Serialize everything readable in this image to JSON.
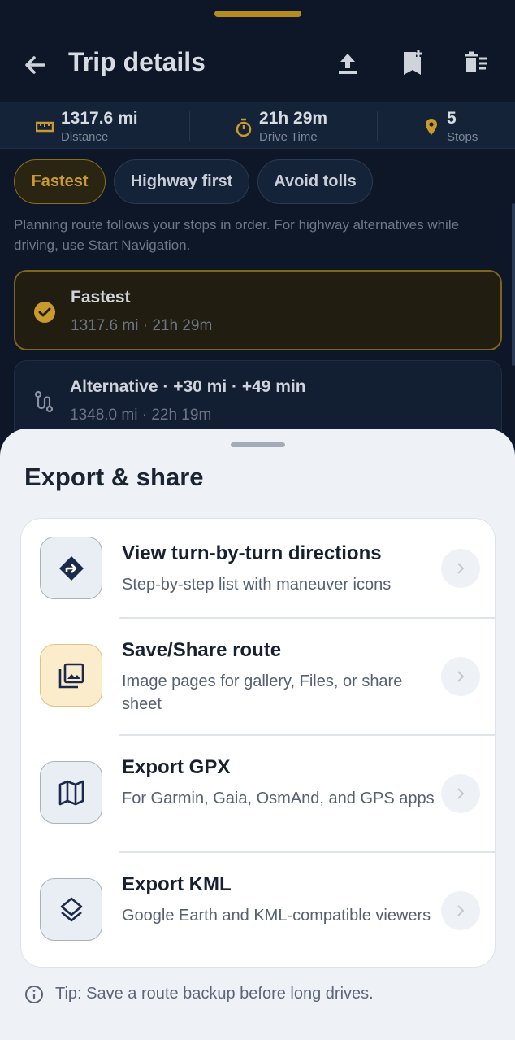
{
  "appbar": {
    "title": "Trip details"
  },
  "stats": [
    {
      "value": "1317.6 mi",
      "label": "Distance",
      "icon": "ruler-icon"
    },
    {
      "value": "21h 29m",
      "label": "Drive Time",
      "icon": "timer-icon"
    },
    {
      "value": "5",
      "label": "Stops",
      "icon": "pin-icon"
    }
  ],
  "chips": [
    {
      "label": "Fastest",
      "selected": true
    },
    {
      "label": "Highway first",
      "selected": false
    },
    {
      "label": "Avoid tolls",
      "selected": false
    }
  ],
  "note": "Planning route follows your stops in order. For highway alternatives while driving, use Start Navigation.",
  "routes": [
    {
      "title": "Fastest",
      "subtitle": "1317.6 mi · 21h 29m",
      "selected": true
    },
    {
      "title": "Alternative · +30 mi · +49 min",
      "subtitle": "1348.0 mi · 22h 19m",
      "selected": false
    }
  ],
  "sheet": {
    "title": "Export & share",
    "items": [
      {
        "title": "View turn-by-turn directions",
        "subtitle": "Step-by-step list with maneuver icons",
        "icon": "directions-icon"
      },
      {
        "title": "Save/Share route",
        "subtitle": "Image pages for gallery, Files, or share sheet",
        "icon": "gallery-icon"
      },
      {
        "title": "Export GPX",
        "subtitle": "For Garmin, Gaia, OsmAnd, and GPS apps",
        "icon": "map-icon"
      },
      {
        "title": "Export KML",
        "subtitle": "Google Earth and KML-compatible viewers",
        "icon": "layers-icon"
      }
    ],
    "tip": "Tip: Save a route backup before long drives."
  },
  "colors": {
    "accent": "#c99b2e",
    "background": "#0e1728",
    "sheet": "#eef2f7"
  }
}
